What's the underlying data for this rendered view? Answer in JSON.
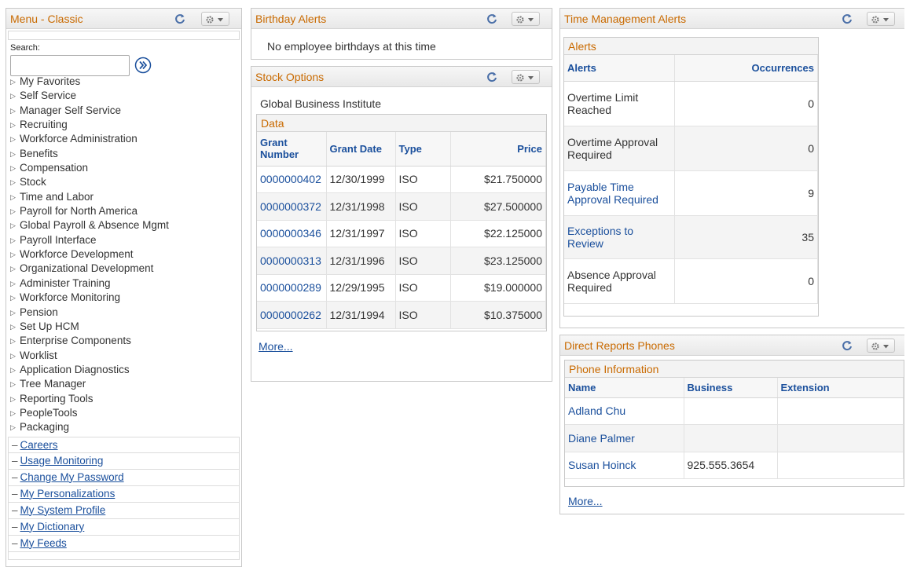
{
  "menu": {
    "title": "Menu - Classic",
    "search_label": "Search:",
    "search_value": "",
    "items": [
      "My Favorites",
      "Self Service",
      "Manager Self Service",
      "Recruiting",
      "Workforce Administration",
      "Benefits",
      "Compensation",
      "Stock",
      "Time and Labor",
      "Payroll for North America",
      "Global Payroll & Absence Mgmt",
      "Payroll Interface",
      "Workforce Development",
      "Organizational Development",
      "Administer Training",
      "Workforce Monitoring",
      "Pension",
      "Set Up HCM",
      "Enterprise Components",
      "Worklist",
      "Application Diagnostics",
      "Tree Manager",
      "Reporting Tools",
      "PeopleTools",
      "Packaging"
    ],
    "links": [
      "Careers",
      "Usage Monitoring",
      "Change My Password",
      "My Personalizations",
      "My System Profile",
      "My Dictionary",
      "My Feeds"
    ]
  },
  "birthday": {
    "title": "Birthday Alerts",
    "message": "No employee birthdays at this time"
  },
  "stock": {
    "title": "Stock Options",
    "company": "Global Business Institute",
    "grid_caption": "Data",
    "columns": [
      "Grant Number",
      "Grant Date",
      "Type",
      "Price"
    ],
    "rows": [
      [
        "0000000402",
        "12/30/1999",
        "ISO",
        "$21.750000"
      ],
      [
        "0000000372",
        "12/31/1998",
        "ISO",
        "$27.500000"
      ],
      [
        "0000000346",
        "12/31/1997",
        "ISO",
        "$22.125000"
      ],
      [
        "0000000313",
        "12/31/1996",
        "ISO",
        "$23.125000"
      ],
      [
        "0000000289",
        "12/29/1995",
        "ISO",
        "$19.000000"
      ],
      [
        "0000000262",
        "12/31/1994",
        "ISO",
        "$10.375000"
      ]
    ],
    "more": "More..."
  },
  "timemgmt": {
    "title": "Time Management Alerts",
    "grid_caption": "Alerts",
    "columns": [
      "Alerts",
      "Occurrences"
    ],
    "rows": [
      [
        "Overtime Limit Reached",
        "0"
      ],
      [
        "Overtime Approval Required",
        "0"
      ],
      [
        "Payable Time Approval Required",
        "9"
      ],
      [
        "Exceptions to Review",
        "35"
      ],
      [
        "Absence Approval Required",
        "0"
      ]
    ]
  },
  "reports": {
    "title": "Direct Reports Phones",
    "grid_caption": "Phone Information",
    "columns": [
      "Name",
      "Business",
      "Extension"
    ],
    "rows": [
      [
        "Adland Chu",
        "",
        ""
      ],
      [
        "Diane Palmer",
        "",
        ""
      ],
      [
        "Susan Hoinck",
        "925.555.3654",
        ""
      ]
    ],
    "more": "More..."
  },
  "colors": {
    "header_title": "#c96a00",
    "link": "#1a4f9c",
    "refresh_icon": "#4a6fa8"
  }
}
